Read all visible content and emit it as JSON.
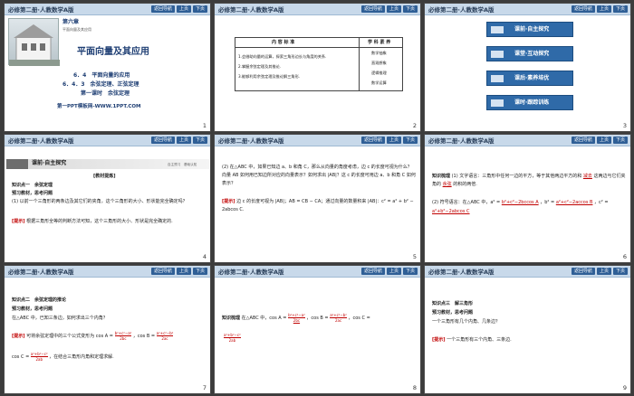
{
  "header": {
    "title": "必修第二册·人教数学A版",
    "nav_label": "返回导航",
    "prev_label": "上页",
    "next_label": "下页"
  },
  "slides": [
    {
      "number": "1",
      "chapter": "第六章",
      "chapter_sub": "平面向量及其应用",
      "main_title": "平面向量及其应用",
      "section_a": "6．4　平面向量的应用",
      "section_b": "6．4．3　余弦定理、正弦定理",
      "lesson": "第一课时　余弦定理",
      "credit": "第一PPT模板网-WWW.1PPT.COM"
    },
    {
      "number": "2",
      "col_target": "内 容 标 准",
      "col_literacy": "学 科 素 养",
      "targets": [
        "1.会借助向量的运算，探索三角形边长与角度的关系.",
        "2.掌握余弦定理及其推论.",
        "3.能够利用余弦定理及推论解三角形."
      ],
      "literacies": [
        "数学抽象",
        "直观想象",
        "逻辑推理",
        "数学运算"
      ]
    },
    {
      "number": "3",
      "menu": [
        "课前·自主探究",
        "课堂·互动探究",
        "课后·素养培优",
        "课时·跟踪训练"
      ]
    },
    {
      "number": "4",
      "section": "课前·自主探究",
      "section_side": "自主预习　基础认知",
      "heading": "[教材提炼]",
      "point": "知识点一　余弦定理",
      "guide": "预习教材，思考问题",
      "q1": "(1) 以前一个三角形的两条边及其它们的夹角，这个三角形的大小、形状能完全确定吗？",
      "answer_tag": "[提示]",
      "answer": "根据三角形全等的判断方法可知，这个三角形的大小、形状是完全确定的."
    },
    {
      "number": "5",
      "p1": "(2) 在△ABC 中，如果已知边 a、b 和角 C，那么从向量的角度考虑，边 c 的长度可视为什么？向量 AB 如何用已知边所对应的向量表示？如何求出 |AB|？这 c 的长度可用边 a、b 和角 C 如何表示？",
      "answer_tag": "[提示]",
      "answer": "边 c 的长度可视为 |AB|；AB = CB − CA；通过向量的数量积来 |AB|：c² = a² + b² − 2abcos C."
    },
    {
      "number": "6",
      "point": "知识梳理",
      "l1": "(1) 文字语言：三角形中任何一边的平方，等于其他两边平方的和",
      "fill1": "减去",
      "l1b": "这两边与它们夹角的",
      "fill2": "余弦",
      "l1c": "的积的两倍.",
      "l2": "(2) 符号语言：在△ABC 中，a² =",
      "f_a": "b²+c²−2bccos A",
      "l2b": "，b² =",
      "f_b": "a²+c²−2accos B",
      "l2c": "，c² =",
      "f_c": "a²+b²−2abcos C"
    },
    {
      "number": "7",
      "point": "知识点二　余弦定理的推论",
      "guide": "预习教材，思考问题",
      "q": "在△ABC 中，已知三条边，如何求出三个内角？",
      "answer_tag": "[提示]",
      "answer_a": "可将余弦定理中的三个公式变形为 cos A =",
      "frac_a_num": "b²+c²−a²",
      "frac_a_den": "2bc",
      "answer_b": "，cos B =",
      "frac_b_num": "a²+c²−b²",
      "frac_b_den": "2ac",
      "answer_c": "cos C =",
      "frac_c_num": "a²+b²−c²",
      "frac_c_den": "2ab",
      "answer_d": "，在结合三角形内角和定理求解."
    },
    {
      "number": "8",
      "point": "知识梳理",
      "text": "在△ABC 中，cos A =",
      "a_num": "b²+c²−a²",
      "a_den": "2bc",
      "text_b": "，cos B =",
      "b_num": "a²+c²−b²",
      "b_den": "2ac",
      "text_c": "，cos C =",
      "c_num": "a²+b²−c²",
      "c_den": "2ab"
    },
    {
      "number": "9",
      "point": "知识点三　解三角形",
      "guide": "预习教材，思考问题",
      "q": "一个三角形有几个内角、几条边？",
      "answer_tag": "[提示]",
      "answer": "一个三角形有三个内角、三条边."
    }
  ],
  "colors": {
    "header_bar": "#c8d9ea",
    "nav_button": "#2f5f96",
    "menu_tile": "#2f6aa8",
    "title_blue": "#1f3f74",
    "answer_red": "#c00000",
    "background": "#3c3c3c"
  }
}
